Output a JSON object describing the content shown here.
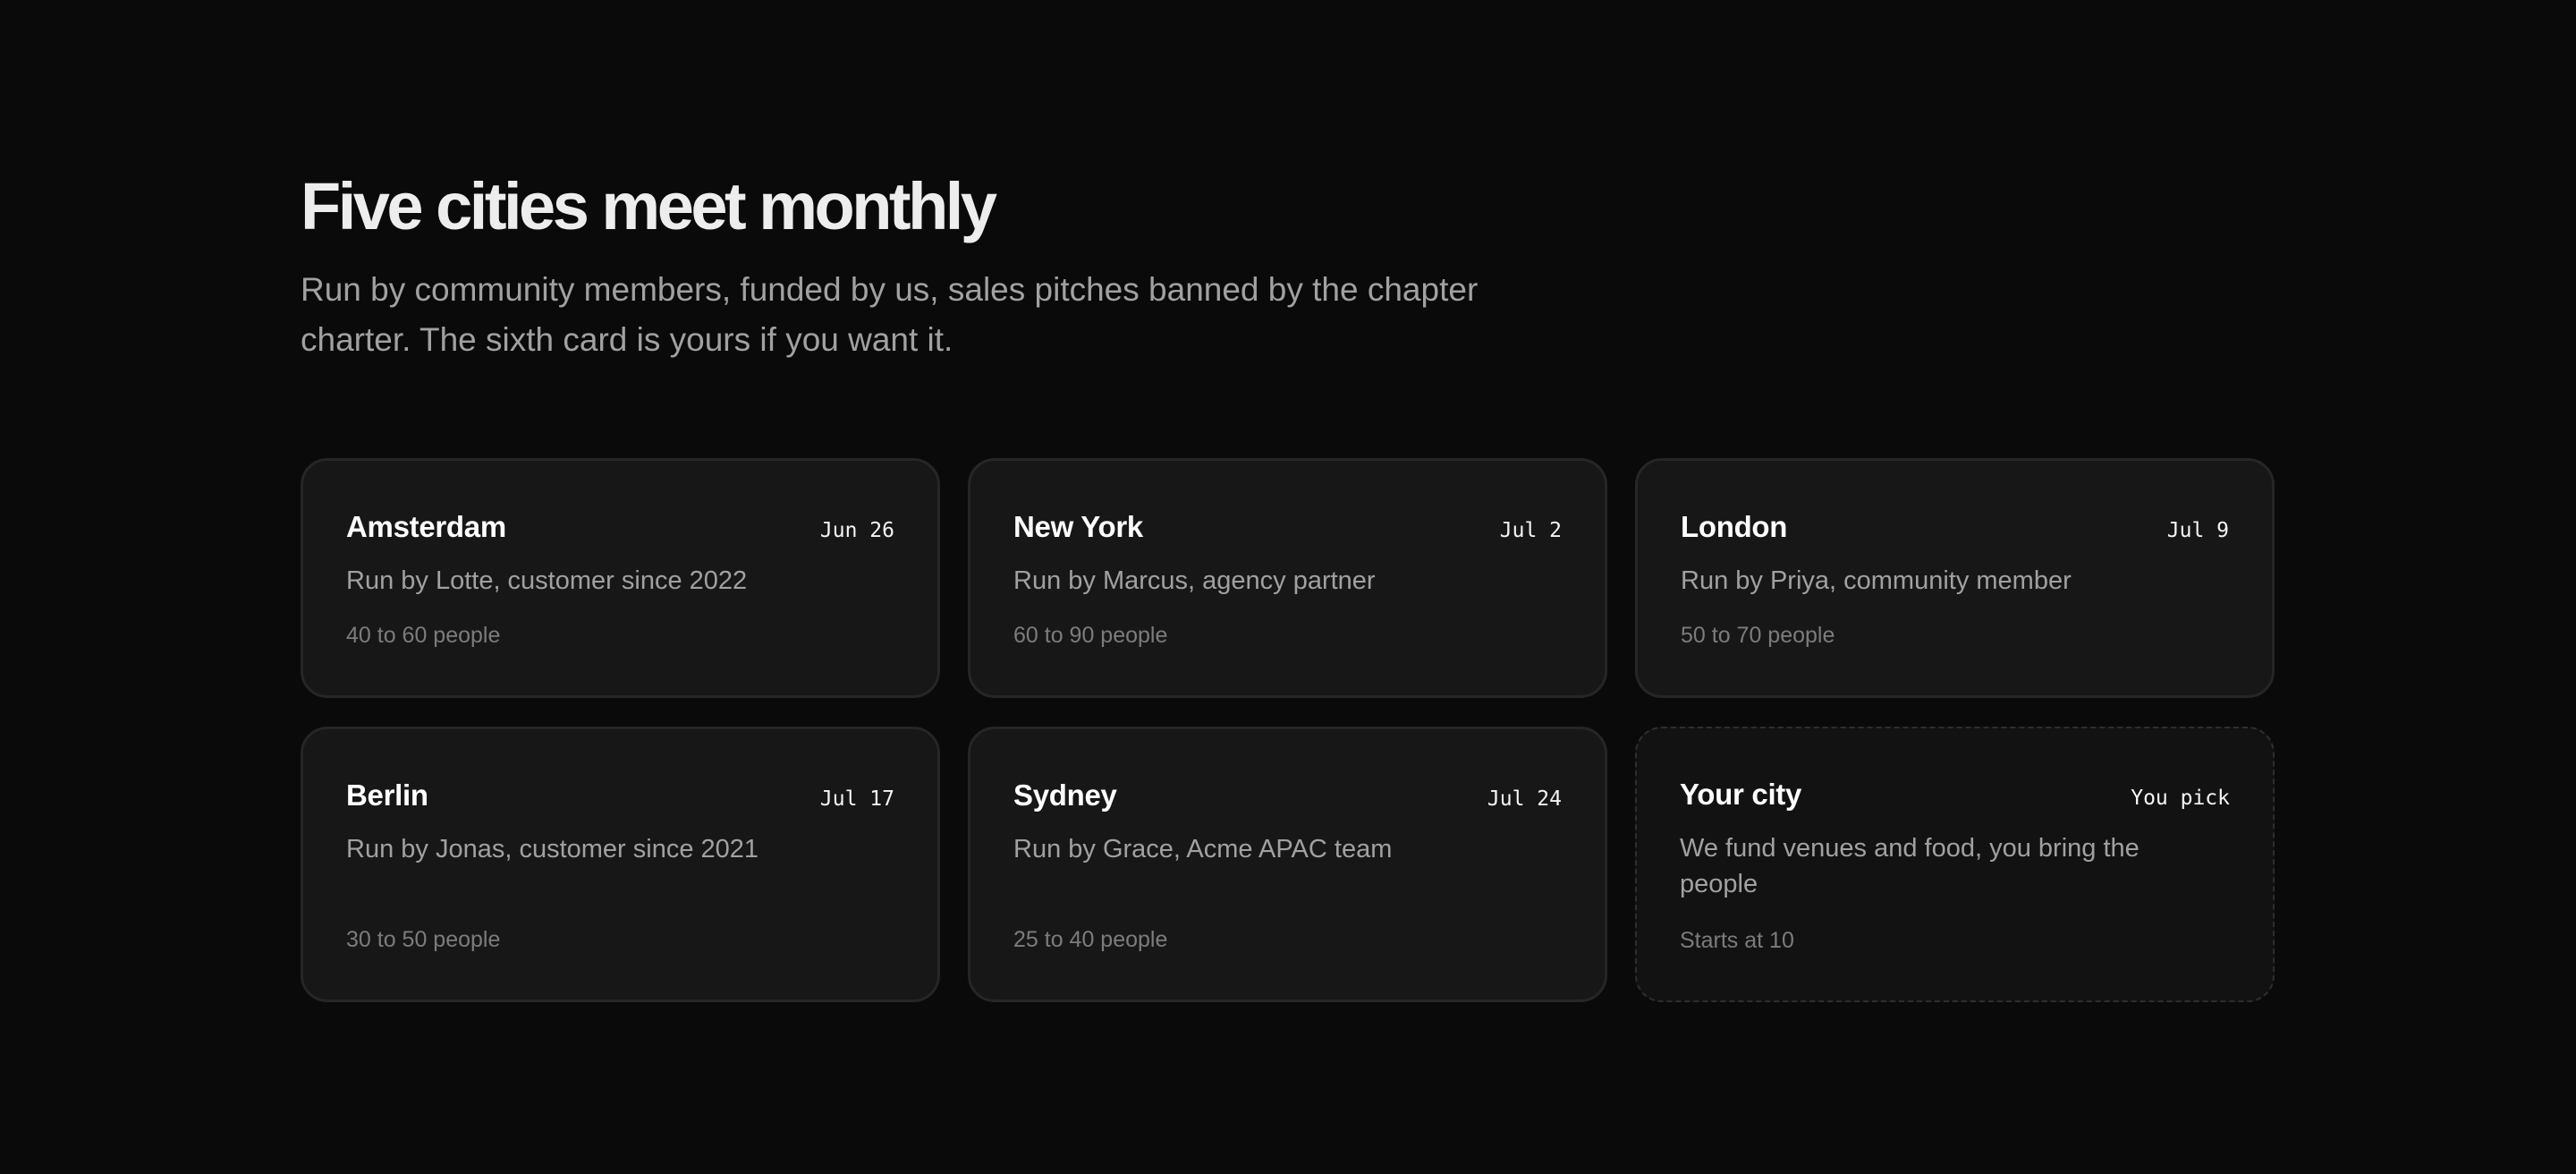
{
  "header": {
    "title": "Five cities meet monthly",
    "subtitle": "Run by community members, funded by us, sales pitches banned by the chapter charter. The sixth card is yours if you want it."
  },
  "cards": [
    {
      "city": "Amsterdam",
      "date": "Jun 26",
      "organizer": "Run by Lotte, customer since 2022",
      "size": "40 to 60 people"
    },
    {
      "city": "New York",
      "date": "Jul 2",
      "organizer": "Run by Marcus, agency partner",
      "size": "60 to 90 people"
    },
    {
      "city": "London",
      "date": "Jul 9",
      "organizer": "Run by Priya, community member",
      "size": "50 to 70 people"
    },
    {
      "city": "Berlin",
      "date": "Jul 17",
      "organizer": "Run by Jonas, customer since 2021",
      "size": "30 to 50 people"
    },
    {
      "city": "Sydney",
      "date": "Jul 24",
      "organizer": "Run by Grace, Acme APAC team",
      "size": "25 to 40 people"
    },
    {
      "city": "Your city",
      "date": "You pick",
      "organizer": "We fund venues and food, you bring the people",
      "size": "Starts at 10"
    }
  ],
  "colors": {
    "background": "#0a0a0a",
    "card": "#171717",
    "card_border": "#262626",
    "text_primary": "#ededed",
    "text_secondary": "#a1a1a1",
    "text_muted": "#7c7c7c"
  }
}
